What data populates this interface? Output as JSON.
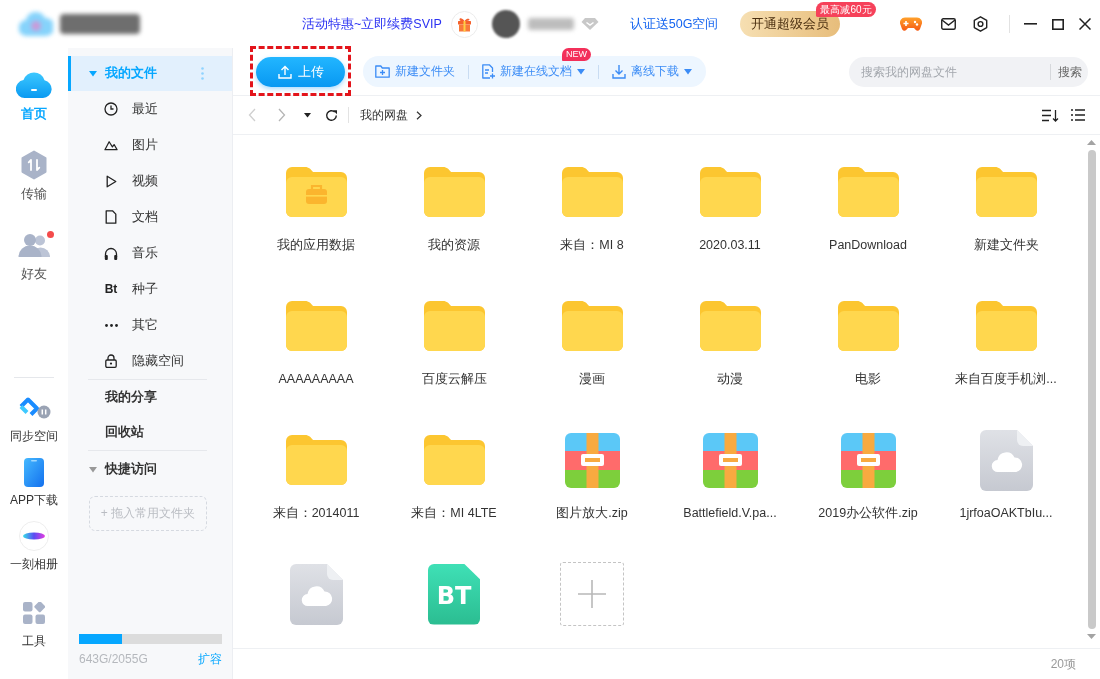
{
  "top_bar": {
    "promo_link": "活动特惠~立即续费SVIP",
    "verify_link": "认证送50G空间",
    "vip_button": {
      "label": "开通超级会员",
      "badge": "最高减60元"
    }
  },
  "rail": {
    "items": [
      {
        "label": "首页",
        "selected": true,
        "notification": false
      },
      {
        "label": "传输",
        "selected": false,
        "notification": false
      },
      {
        "label": "好友",
        "selected": false,
        "notification": true
      }
    ],
    "apps": [
      {
        "label": "同步空间"
      },
      {
        "label": "APP下载"
      },
      {
        "label": "一刻相册"
      },
      {
        "label": "工具"
      }
    ]
  },
  "sidebar": {
    "my_files": {
      "label": "我的文件",
      "selected": true,
      "expanded": true,
      "children": [
        {
          "label": "最近",
          "selected": false
        },
        {
          "label": "图片",
          "selected": false
        },
        {
          "label": "视频",
          "selected": false
        },
        {
          "label": "文档",
          "selected": false
        },
        {
          "label": "音乐",
          "selected": false
        },
        {
          "label": "种子",
          "icon_text": "Bt",
          "selected": false
        },
        {
          "label": "其它",
          "selected": false
        },
        {
          "label": "隐藏空间",
          "selected": false
        }
      ]
    },
    "links": [
      {
        "label": "我的分享",
        "selected": false
      },
      {
        "label": "回收站",
        "selected": false
      }
    ],
    "quick_access": {
      "label": "快捷访问",
      "expanded": true,
      "drop_hint": "+ 拖入常用文件夹"
    },
    "storage": {
      "level": 0.3,
      "reading": "643G/2055G",
      "expand_link": "扩容"
    }
  },
  "toolbar": {
    "upload_button": {
      "label": "上传",
      "highlighted": true
    },
    "actions": [
      {
        "label": "新建文件夹",
        "dropdown": false
      },
      {
        "label": "新建在线文档",
        "dropdown": true,
        "badge": "NEW"
      },
      {
        "label": "离线下载",
        "dropdown": true
      }
    ],
    "search": {
      "placeholder": "搜索我的网盘文件",
      "button": "搜索"
    }
  },
  "navigation": {
    "back": {
      "disabled": true
    },
    "forward": {
      "disabled": true
    },
    "breadcrumb": [
      {
        "label": "我的网盘"
      }
    ]
  },
  "files": [
    {
      "kind": "app-folder",
      "name": "我的应用数据"
    },
    {
      "kind": "folder",
      "name": "我的资源"
    },
    {
      "kind": "folder",
      "name": "来自：MI 8"
    },
    {
      "kind": "folder",
      "name": "2020.03.11"
    },
    {
      "kind": "folder",
      "name": "PanDownload"
    },
    {
      "kind": "folder",
      "name": "新建文件夹"
    },
    {
      "kind": "folder",
      "name": "AAAAAAAAA"
    },
    {
      "kind": "folder",
      "name": "百度云解压"
    },
    {
      "kind": "folder",
      "name": "漫画"
    },
    {
      "kind": "folder",
      "name": "动漫"
    },
    {
      "kind": "folder",
      "name": "电影"
    },
    {
      "kind": "folder",
      "name": "来自百度手机浏..."
    },
    {
      "kind": "folder",
      "name": "来自：2014011"
    },
    {
      "kind": "folder",
      "name": "来自：MI 4LTE"
    },
    {
      "kind": "zip",
      "name": "图片放大.zip"
    },
    {
      "kind": "zip",
      "name": "Battlefield.V.pa..."
    },
    {
      "kind": "zip",
      "name": "2019办公软件.zip"
    },
    {
      "kind": "cloud-file",
      "name": "1jrfoaOAKTbIu..."
    },
    {
      "kind": "cloud-file"
    },
    {
      "kind": "bt",
      "icon_text": "BT"
    },
    {
      "kind": "upload"
    }
  ],
  "status_bar": {
    "count": "20项"
  }
}
